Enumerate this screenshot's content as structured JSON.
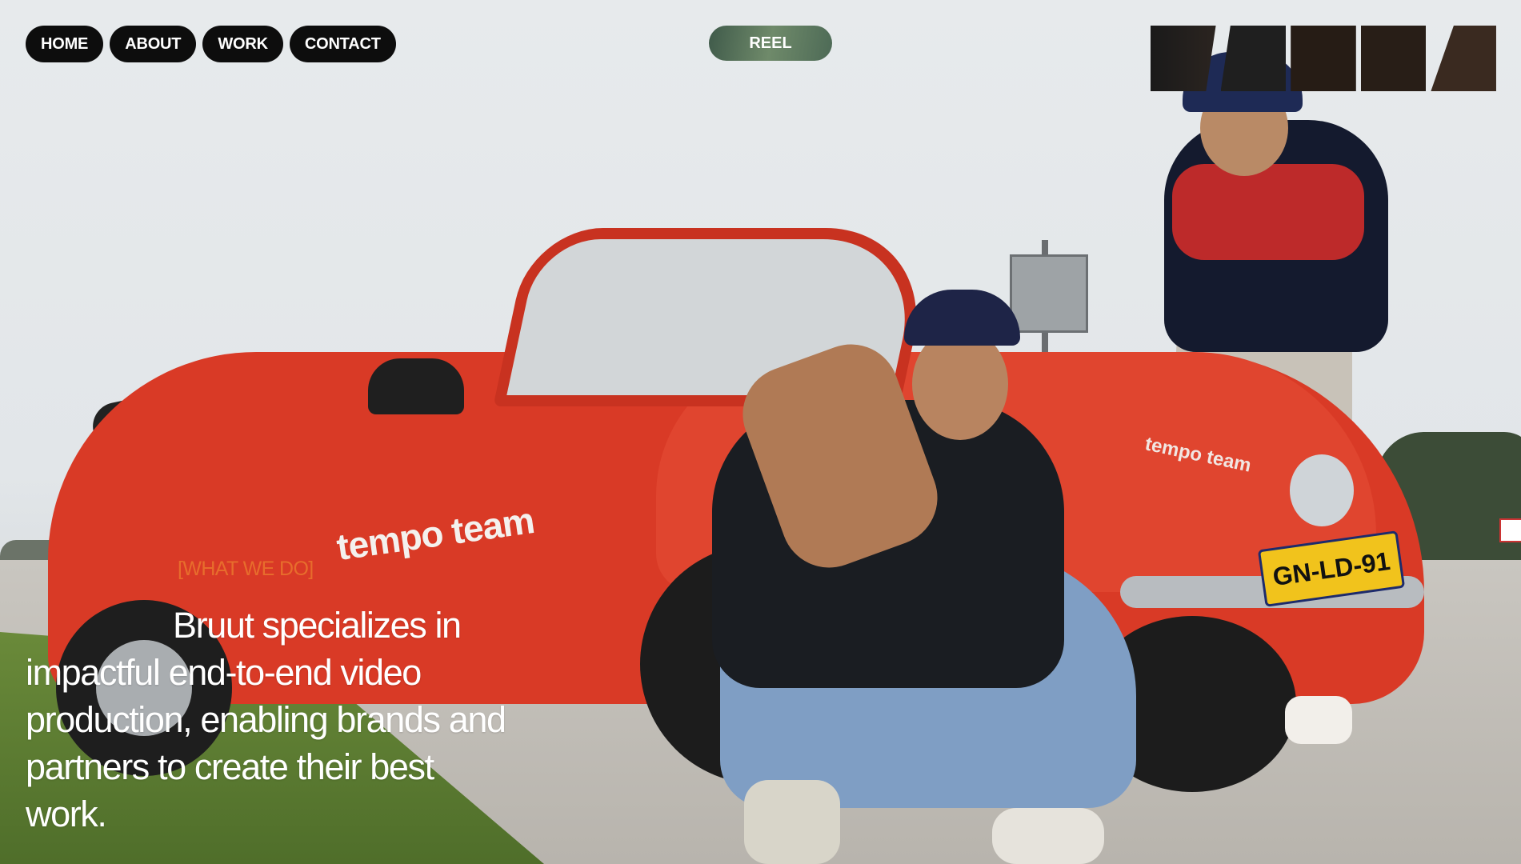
{
  "nav": {
    "items": [
      {
        "label": "HOME"
      },
      {
        "label": "ABOUT"
      },
      {
        "label": "WORK"
      },
      {
        "label": "CONTACT"
      }
    ]
  },
  "reel": {
    "label": "REEL"
  },
  "brand": {
    "logo_icon": "bruut-logo"
  },
  "hero": {
    "section_label": "[WHAT WE DO]",
    "headline": "Bruut specializes in impactful end-to-end video production, enabling brands and partners to create their best work.",
    "car_text": "tempo team",
    "plate": "GN-LD-91"
  },
  "colors": {
    "accent": "#e76d2c",
    "nav_bg": "#0d0d0d",
    "nav_text": "#ffffff"
  }
}
